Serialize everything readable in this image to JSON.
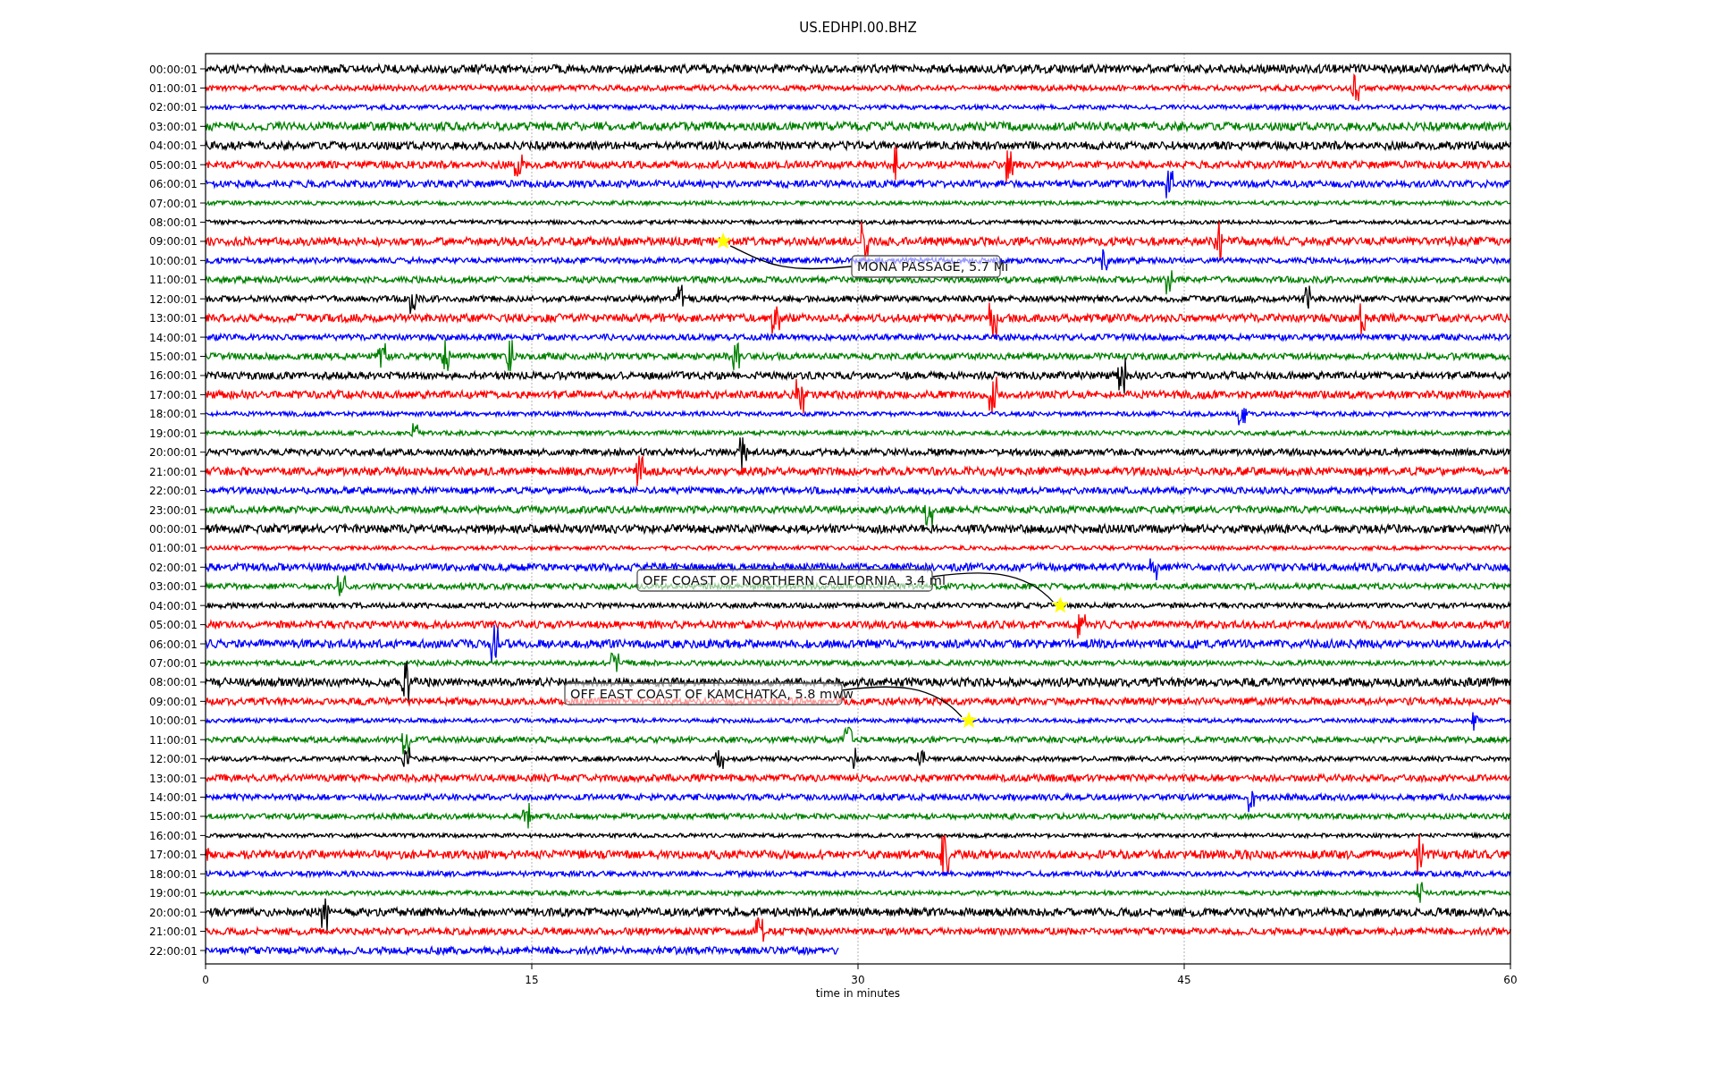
{
  "title": "US.EDHPI.00.BHZ",
  "x_axis": {
    "label": "time in minutes",
    "ticks": [
      "0",
      "15",
      "30",
      "45",
      "60"
    ]
  },
  "traces": [
    {
      "label": "00:00:01",
      "color": "#000000",
      "level": 1
    },
    {
      "label": "01:00:01",
      "color": "#ff0000",
      "level": 1
    },
    {
      "label": "02:00:01",
      "color": "#0000ff",
      "level": 1
    },
    {
      "label": "03:00:01",
      "color": "#008000",
      "level": 1
    },
    {
      "label": "04:00:01",
      "color": "#000000",
      "level": 1
    },
    {
      "label": "05:00:01",
      "color": "#ff0000",
      "level": 1
    },
    {
      "label": "06:00:01",
      "color": "#0000ff",
      "level": 1
    },
    {
      "label": "07:00:01",
      "color": "#008000",
      "level": 1
    },
    {
      "label": "08:00:01",
      "color": "#000000",
      "level": 1
    },
    {
      "label": "09:00:01",
      "color": "#ff0000",
      "level": 1,
      "event": {
        "label": "MONA PASSAGE, 5.7 Mi"
      }
    },
    {
      "label": "10:00:01",
      "color": "#0000ff",
      "level": 1
    },
    {
      "label": "11:00:01",
      "color": "#008000",
      "level": 1
    },
    {
      "label": "12:00:01",
      "color": "#000000",
      "level": 1
    },
    {
      "label": "13:00:01",
      "color": "#ff0000",
      "level": 1
    },
    {
      "label": "14:00:01",
      "color": "#0000ff",
      "level": 1
    },
    {
      "label": "15:00:01",
      "color": "#008000",
      "level": 1
    },
    {
      "label": "16:00:01",
      "color": "#000000",
      "level": 1
    },
    {
      "label": "17:00:01",
      "color": "#ff0000",
      "level": 1
    },
    {
      "label": "18:00:01",
      "color": "#0000ff",
      "level": 1
    },
    {
      "label": "19:00:01",
      "color": "#008000",
      "level": 1
    },
    {
      "label": "20:00:01",
      "color": "#000000",
      "level": 1
    },
    {
      "label": "21:00:01",
      "color": "#ff0000",
      "level": 1
    },
    {
      "label": "22:00:01",
      "color": "#0000ff",
      "level": 1
    },
    {
      "label": "23:00:01",
      "color": "#008000",
      "level": 1
    },
    {
      "label": "00:00:01",
      "color": "#000000",
      "level": 1
    },
    {
      "label": "01:00:01",
      "color": "#ff0000",
      "level": 1
    },
    {
      "label": "02:00:01",
      "color": "#0000ff",
      "level": 1
    },
    {
      "label": "03:00:01",
      "color": "#008000",
      "level": 1
    },
    {
      "label": "04:00:01",
      "color": "#000000",
      "level": 1,
      "event": {
        "label": "OFF COAST OF NORTHERN CALIFORNIA, 3.4 ml"
      }
    },
    {
      "label": "05:00:01",
      "color": "#ff0000",
      "level": 1
    },
    {
      "label": "06:00:01",
      "color": "#0000ff",
      "level": 1
    },
    {
      "label": "07:00:01",
      "color": "#008000",
      "level": 1
    },
    {
      "label": "08:00:01",
      "color": "#000000",
      "level": 1
    },
    {
      "label": "09:00:01",
      "color": "#ff0000",
      "level": 1
    },
    {
      "label": "10:00:01",
      "color": "#0000ff",
      "level": 1,
      "event": {
        "label": "OFF EAST COAST OF KAMCHATKA, 5.8 mww"
      }
    },
    {
      "label": "11:00:01",
      "color": "#008000",
      "level": 1
    },
    {
      "label": "12:00:01",
      "color": "#000000",
      "level": 1
    },
    {
      "label": "13:00:01",
      "color": "#ff0000",
      "level": 1
    },
    {
      "label": "14:00:01",
      "color": "#0000ff",
      "level": 1
    },
    {
      "label": "15:00:01",
      "color": "#008000",
      "level": 1
    },
    {
      "label": "16:00:01",
      "color": "#000000",
      "level": 1
    },
    {
      "label": "17:00:01",
      "color": "#ff0000",
      "level": 1
    },
    {
      "label": "18:00:01",
      "color": "#0000ff",
      "level": 1
    },
    {
      "label": "19:00:01",
      "color": "#008000",
      "level": 1
    },
    {
      "label": "20:00:01",
      "color": "#000000",
      "level": 1
    },
    {
      "label": "21:00:01",
      "color": "#ff0000",
      "level": 1
    },
    {
      "label": "22:00:01",
      "color": "#0000ff",
      "level": 0.485
    }
  ]
}
